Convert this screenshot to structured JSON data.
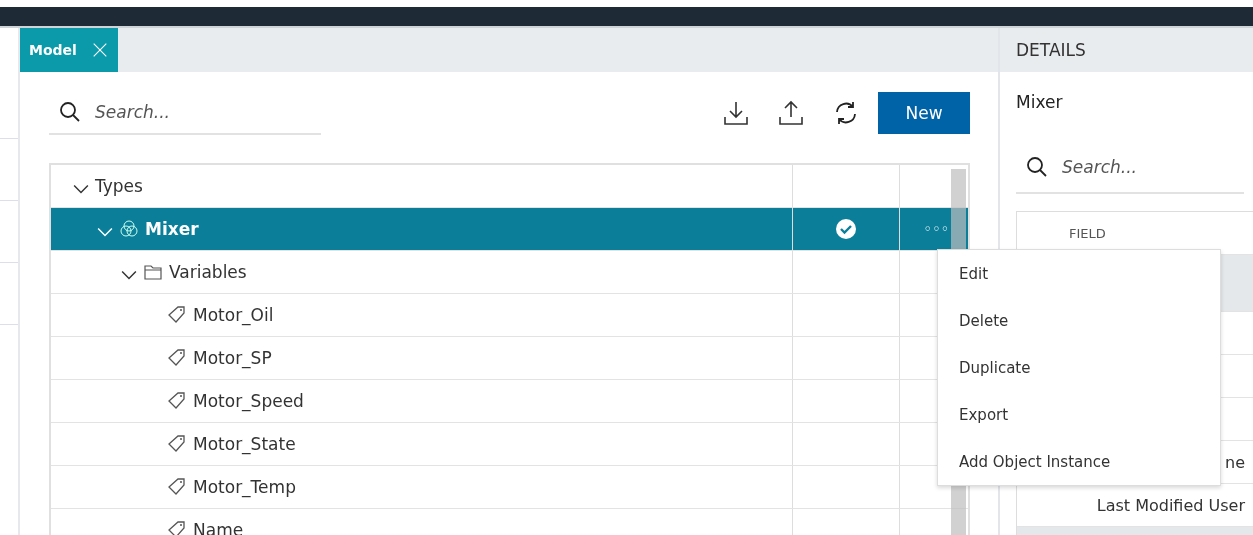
{
  "tabs": [
    {
      "label": "Model",
      "selected": true
    }
  ],
  "toolbar": {
    "search": {
      "placeholder": "Search..."
    },
    "new_button": "New"
  },
  "tree": [
    {
      "label": "Types",
      "kind": "group",
      "expanded": true,
      "selected": false,
      "children": [
        {
          "label": "Mixer",
          "kind": "type",
          "expanded": true,
          "selected": true,
          "checked": true,
          "more": "◦◦◦",
          "children": [
            {
              "label": "Variables",
              "kind": "folder",
              "expanded": true,
              "selected": false,
              "children": [
                {
                  "label": "Motor_Oil",
                  "kind": "tag",
                  "selected": false
                },
                {
                  "label": "Motor_SP",
                  "kind": "tag",
                  "selected": false
                },
                {
                  "label": "Motor_Speed",
                  "kind": "tag",
                  "selected": false
                },
                {
                  "label": "Motor_State",
                  "kind": "tag",
                  "selected": false
                },
                {
                  "label": "Motor_Temp",
                  "kind": "tag",
                  "selected": false
                },
                {
                  "label": "Name",
                  "kind": "tag",
                  "selected": false
                }
              ]
            }
          ]
        }
      ]
    }
  ],
  "context_menu": [
    "Edit",
    "Delete",
    "Duplicate",
    "Export",
    "Add Object Instance"
  ],
  "details": {
    "title": "DETAILS",
    "name": "Mixer",
    "search": {
      "placeholder": "Search..."
    },
    "column": "FIELD",
    "rows": [
      {
        "kind": "group"
      },
      {
        "kind": "field"
      },
      {
        "kind": "field"
      },
      {
        "kind": "field"
      },
      {
        "kind": "field",
        "label": "ne"
      },
      {
        "kind": "field",
        "label": "Last Modified User"
      },
      {
        "kind": "group"
      }
    ]
  }
}
